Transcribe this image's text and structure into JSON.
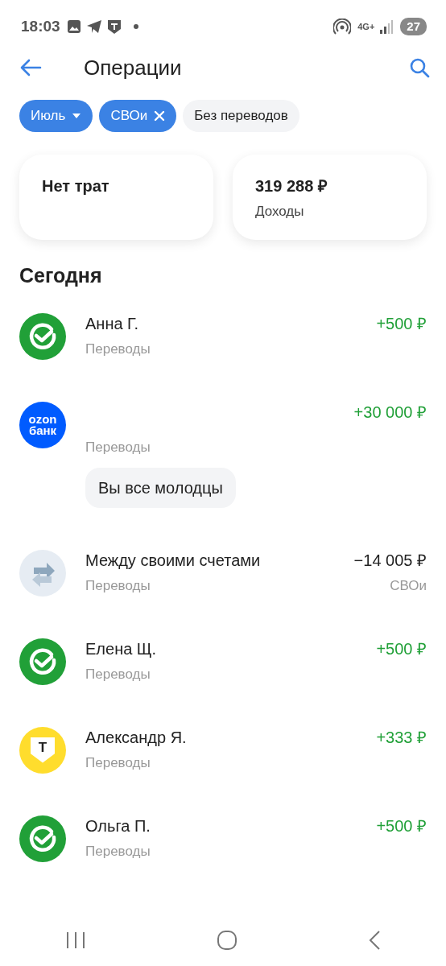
{
  "status_bar": {
    "time": "18:03",
    "network": "4G+",
    "battery": "27"
  },
  "header": {
    "title": "Операции"
  },
  "filters": [
    {
      "label": "Июль",
      "kind": "dropdown",
      "selected": true
    },
    {
      "label": "СВОи",
      "kind": "removable",
      "selected": true
    },
    {
      "label": "Без переводов",
      "kind": "plain",
      "selected": false
    }
  ],
  "summary": [
    {
      "value": "Нет трат"
    },
    {
      "value": "319 288 ₽",
      "caption": "Доходы"
    }
  ],
  "section_title": "Сегодня",
  "operations": [
    {
      "kind": "check",
      "name": "Анна Г.",
      "category": "Переводы",
      "amount": "+500 ₽",
      "credit": true
    },
    {
      "kind": "logo",
      "logo_text": [
        "ozon",
        "банк"
      ],
      "category": "Переводы",
      "amount": "+30 000 ₽",
      "credit": true,
      "comment": "Вы все молодцы"
    },
    {
      "kind": "arrows",
      "name": "Между своими счетами",
      "category": "Переводы",
      "amount": "−14 005 ₽",
      "credit": false,
      "account": "СВОи"
    },
    {
      "kind": "check",
      "name": "Елена Щ.",
      "category": "Переводы",
      "amount": "+500 ₽",
      "credit": true
    },
    {
      "kind": "shield",
      "logo_text": [
        "Т"
      ],
      "name": "Александр Я.",
      "category": "Переводы",
      "amount": "+333 ₽",
      "credit": true
    },
    {
      "kind": "check",
      "name": "Ольга П.",
      "category": "Переводы",
      "amount": "+500 ₽",
      "credit": true
    }
  ]
}
